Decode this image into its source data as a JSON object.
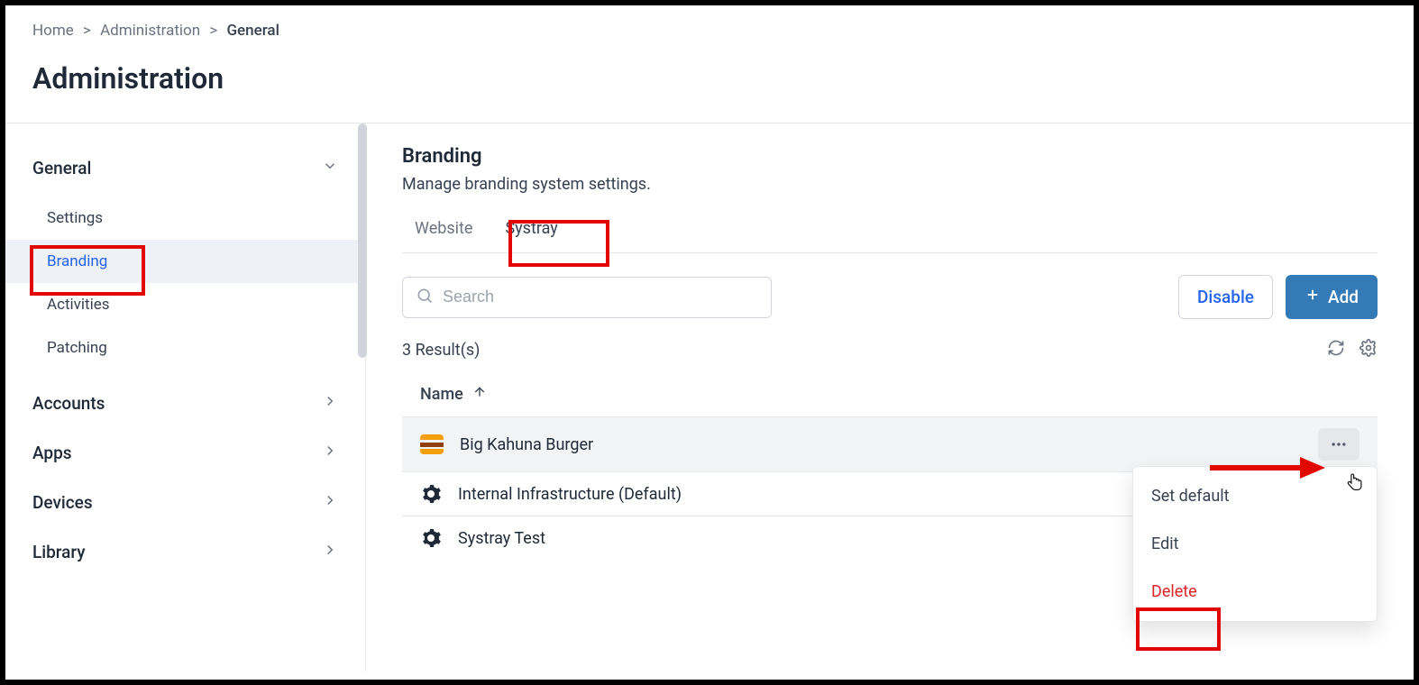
{
  "breadcrumb": {
    "items": [
      "Home",
      "Administration",
      "General"
    ]
  },
  "page_title": "Administration",
  "sidebar": {
    "sections": [
      {
        "label": "General",
        "expanded": true,
        "items": [
          {
            "label": "Settings"
          },
          {
            "label": "Branding",
            "active": true
          },
          {
            "label": "Activities"
          },
          {
            "label": "Patching"
          }
        ]
      },
      {
        "label": "Accounts",
        "expanded": false
      },
      {
        "label": "Apps",
        "expanded": false
      },
      {
        "label": "Devices",
        "expanded": false
      },
      {
        "label": "Library",
        "expanded": false
      }
    ]
  },
  "main": {
    "title": "Branding",
    "subtitle": "Manage branding system settings.",
    "tabs": [
      {
        "label": "Website"
      },
      {
        "label": "Systray",
        "active": true
      }
    ],
    "search_placeholder": "Search",
    "disable_label": "Disable",
    "add_label": "Add",
    "results_text": "3 Result(s)",
    "column_header": "Name",
    "rows": [
      {
        "name": "Big Kahuna Burger",
        "icon": "burger",
        "hovered": true
      },
      {
        "name": "Internal Infrastructure (Default)",
        "icon": "gear"
      },
      {
        "name": "Systray Test",
        "icon": "gear"
      }
    ],
    "dropdown": {
      "set_default": "Set default",
      "edit": "Edit",
      "delete": "Delete"
    }
  }
}
